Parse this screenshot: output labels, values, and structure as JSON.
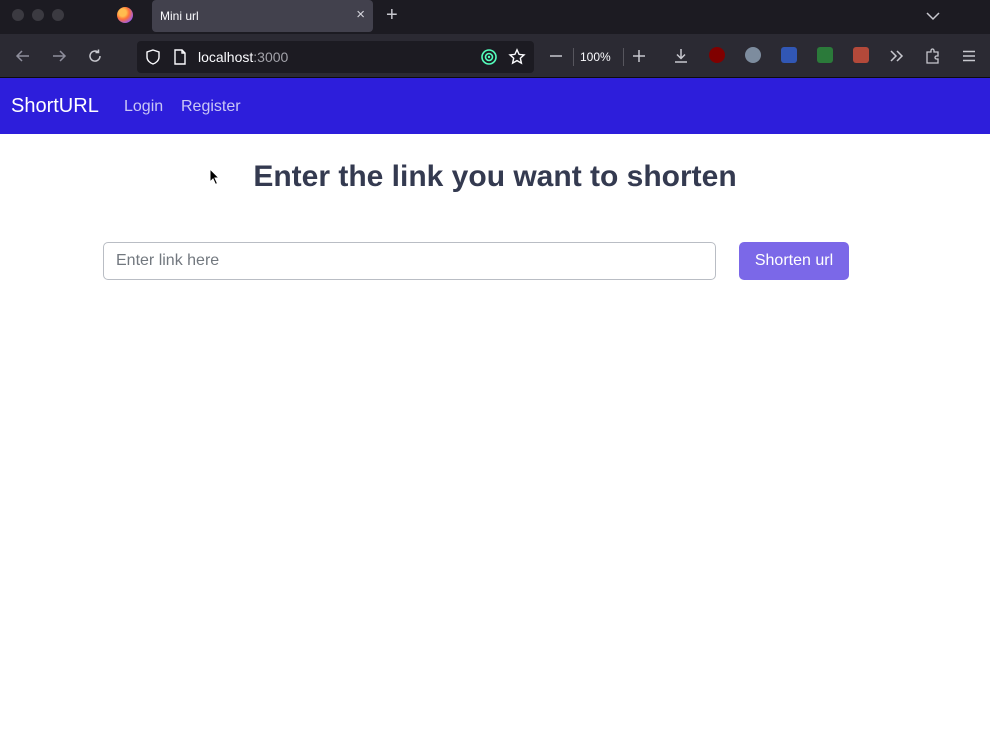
{
  "browser": {
    "tab_title": "Mini url",
    "url_host": "localhost",
    "url_port": ":3000",
    "zoom": "100%",
    "icons": [
      "firefox-logo",
      "back-arrow",
      "forward-arrow",
      "reload",
      "shield",
      "page",
      "vpn",
      "star",
      "zoom-out",
      "zoom-in",
      "download",
      "ublock",
      "extension",
      "overflow",
      "puzzle",
      "menu"
    ]
  },
  "navbar": {
    "brand": "ShortURL",
    "links": [
      {
        "label": "Login"
      },
      {
        "label": "Register"
      }
    ],
    "color": "#2d1edb"
  },
  "main": {
    "heading": "Enter the link you want to shorten",
    "input": {
      "placeholder": "Enter link here",
      "value": ""
    },
    "button_label": "Shorten url",
    "button_color": "#7b68e8"
  }
}
